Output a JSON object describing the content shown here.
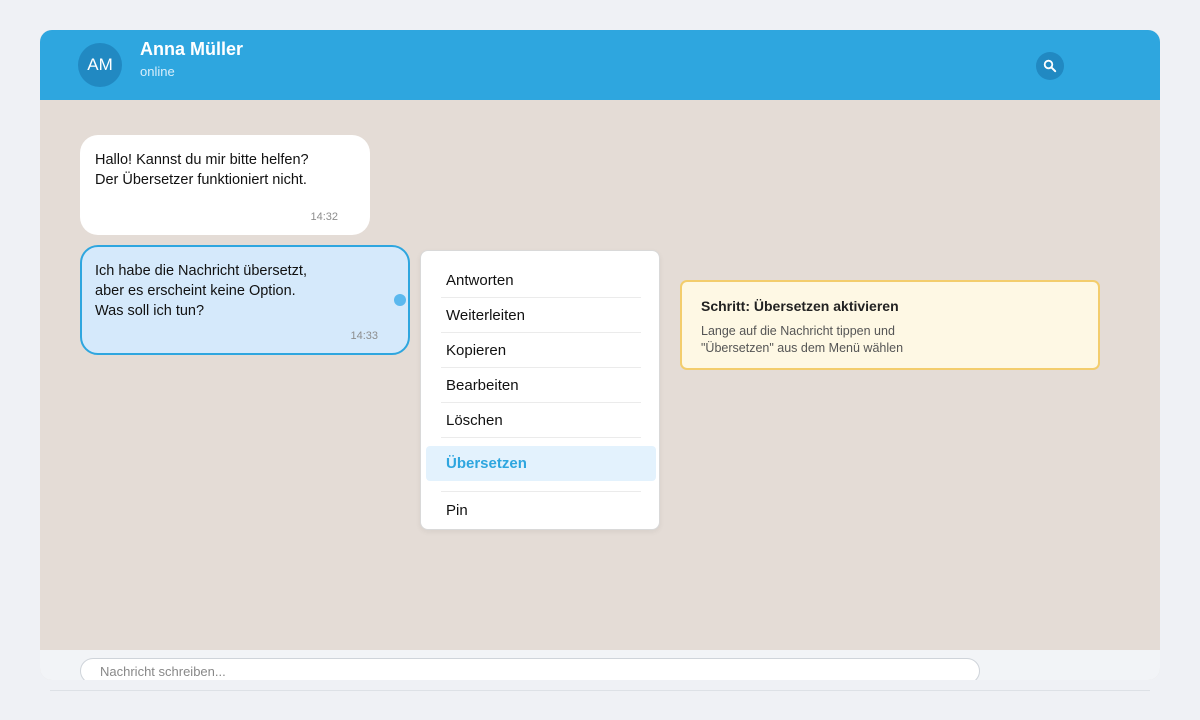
{
  "header": {
    "avatar_initials": "AM",
    "contact_name": "Anna Müller",
    "status": "online",
    "icons": {
      "search": "search-icon"
    }
  },
  "messages": [
    {
      "direction": "incoming",
      "lines": [
        "Hallo! Kannst du mir bitte helfen?",
        "Der Übersetzer funktioniert nicht."
      ],
      "time": "14:32"
    },
    {
      "direction": "outgoing",
      "selected": true,
      "lines": [
        "Ich habe die Nachricht übersetzt,",
        "aber es erscheint keine Option.",
        "Was soll ich tun?"
      ],
      "time": "14:33"
    }
  ],
  "context_menu": {
    "items": [
      "Antworten",
      "Weiterleiten",
      "Kopieren",
      "Bearbeiten",
      "Löschen",
      "Übersetzen",
      "Pin"
    ],
    "highlighted": "Übersetzen"
  },
  "hint": {
    "title": "Schritt: Übersetzen aktivieren",
    "body_lines": [
      "Lange auf die Nachricht tippen und",
      "\"Übersetzen\" aus dem Menü wählen"
    ]
  },
  "composer": {
    "placeholder": "Nachricht schreiben..."
  },
  "colors": {
    "header": "#2ea6df",
    "chat_background": "#e4dcd6",
    "outgoing_bubble": "#d5e9fb",
    "accent": "#2ea6df",
    "hint_background": "#fef8e4",
    "hint_border": "#f3cd6d"
  }
}
